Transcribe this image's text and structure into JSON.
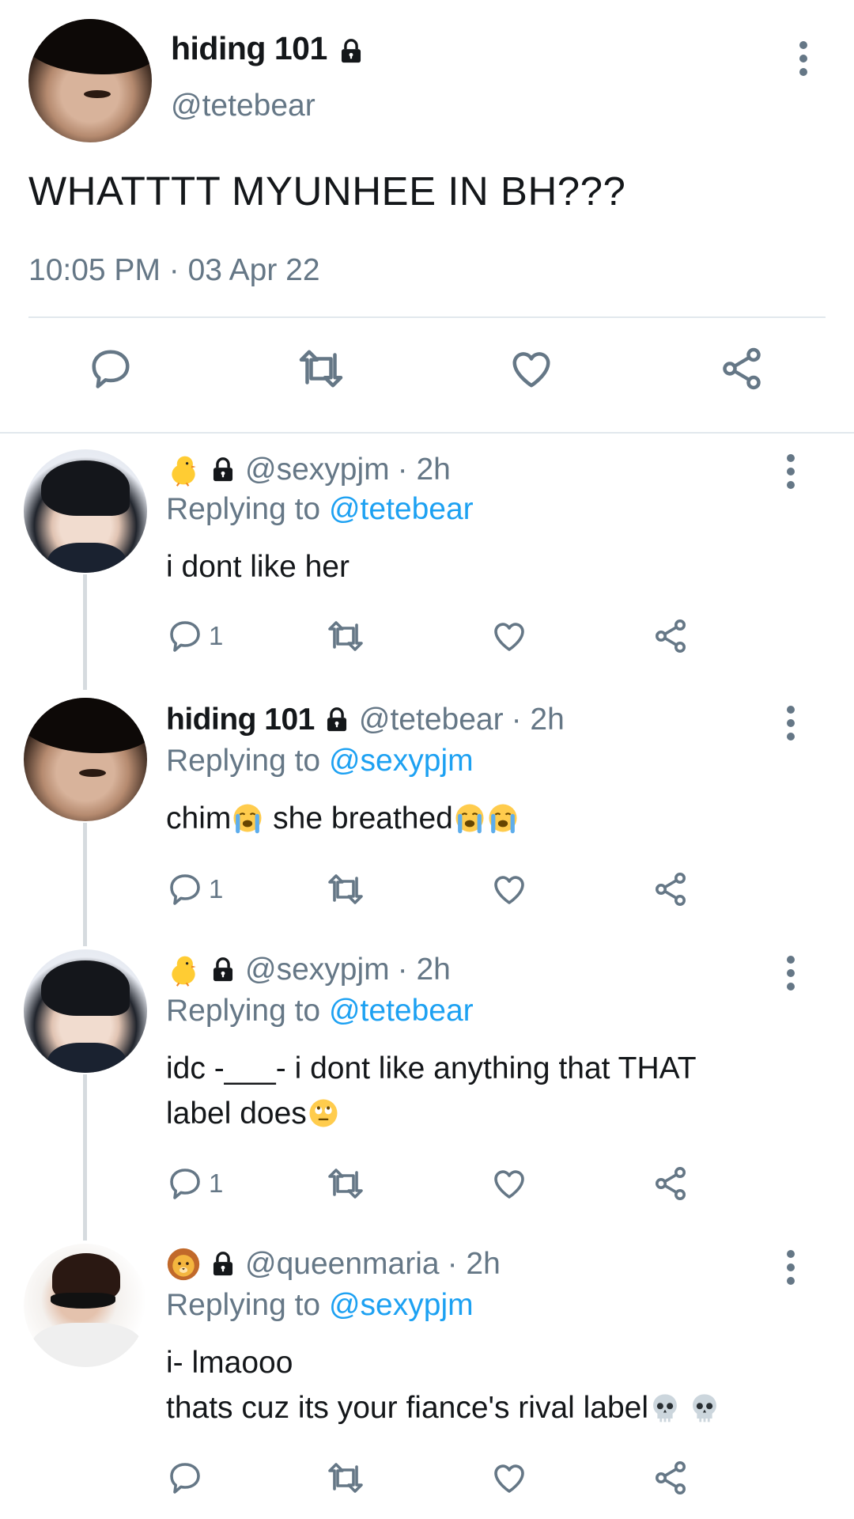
{
  "main_tweet": {
    "name": "hiding 101",
    "handle": "@tetebear",
    "text": "WHATTTT MYUNHEE IN BH???",
    "timestamp": "10:05 PM · 03 Apr 22"
  },
  "replies": [
    {
      "handle": "@sexypjm",
      "time": "· 2h",
      "replying_prefix": "Replying to",
      "replying_to": "@tetebear",
      "text_lines": [
        "i dont like her"
      ],
      "reply_count": "1"
    },
    {
      "name": "hiding 101",
      "handle": "@tetebear",
      "time": "· 2h",
      "replying_prefix": "Replying to",
      "replying_to": "@sexypjm",
      "text_parts": [
        "chim",
        " she breathed"
      ],
      "reply_count": "1"
    },
    {
      "handle": "@sexypjm",
      "time": "· 2h",
      "replying_prefix": "Replying to",
      "replying_to": "@tetebear",
      "text_lines": [
        "idc -___- i dont like anything that THAT",
        "label does"
      ],
      "reply_count": "1"
    },
    {
      "handle": "@queenmaria",
      "time": "· 2h",
      "replying_prefix": "Replying to",
      "replying_to": "@sexypjm",
      "text_lines": [
        "i- lmaooo",
        "thats cuz its your fiance's rival label"
      ],
      "reply_count": ""
    }
  ],
  "icons": {
    "reply": "speech-bubble-icon",
    "retweet": "retweet-icon",
    "like": "heart-icon",
    "share": "share-icon",
    "more": "vertical-dots-icon",
    "lock": "padlock-icon"
  },
  "colors": {
    "link": "#1da1f2",
    "secondary_text": "#657786",
    "primary_text": "#14171a",
    "divider": "#e1e8ed"
  }
}
